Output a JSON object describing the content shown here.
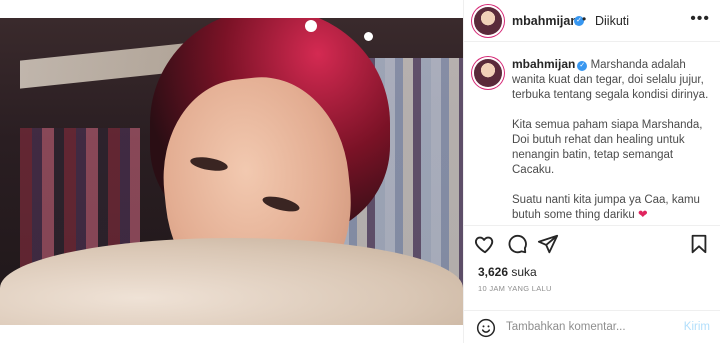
{
  "post": {
    "username": "mbahmijan",
    "verified_icon": "verified-badge-icon",
    "separator": "•",
    "follow_status": "Diikuti",
    "more_icon": "more-options-icon"
  },
  "caption": {
    "username": "mbahmijan",
    "paragraphs": [
      "Marshanda adalah wanita kuat dan tegar, doi selalu jujur, terbuka tentang segala kondisi dirinya.",
      "Kita semua paham siapa Marshanda, Doi butuh rehat dan healing untuk nenangin batin, tetap semangat Cacaku.",
      "Suatu nanti kita jumpa ya Caa, kamu butuh some thing dariku"
    ],
    "heart_emoji": "❤"
  },
  "actions": {
    "like_icon": "heart-outline-icon",
    "comment_icon": "comment-bubble-icon",
    "share_icon": "paper-plane-icon",
    "save_icon": "bookmark-icon",
    "likes_count": "3,626",
    "likes_unit": "suka",
    "timestamp": "10 JAM YANG LALU"
  },
  "comment": {
    "emoji_icon": "smiley-icon",
    "placeholder": "Tambahkan komentar...",
    "post_label": "Kirim"
  },
  "colors": {
    "verified": "#3897f0",
    "post_button_disabled": "#b2dffc",
    "meta_text": "#8e8e8e"
  }
}
